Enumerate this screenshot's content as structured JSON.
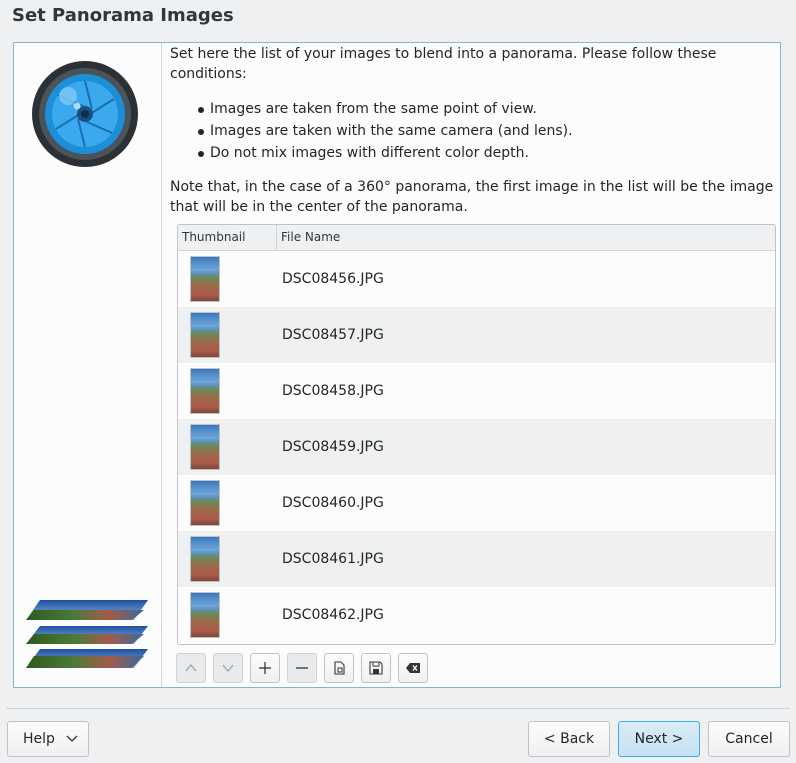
{
  "page_title": "Set Panorama Images",
  "intro": "Set here the list of your images to blend into a panorama. Please follow these conditions:",
  "conditions": [
    "Images are taken from the same point of view.",
    "Images are taken with the same camera (and lens).",
    "Do not mix images with different color depth."
  ],
  "note": "Note that, in the case of a 360° panorama, the first image in the list will be the image that will be in the center of the panorama.",
  "table": {
    "columns": [
      "Thumbnail",
      "File Name"
    ],
    "rows": [
      {
        "file": "DSC08456.JPG"
      },
      {
        "file": "DSC08457.JPG"
      },
      {
        "file": "DSC08458.JPG"
      },
      {
        "file": "DSC08459.JPG"
      },
      {
        "file": "DSC08460.JPG"
      },
      {
        "file": "DSC08461.JPG"
      },
      {
        "file": "DSC08462.JPG"
      }
    ]
  },
  "toolbar": {
    "move_up_icon": "arrow-up-icon",
    "move_down_icon": "arrow-down-icon",
    "add_icon": "plus-icon",
    "remove_icon": "minus-icon",
    "load_icon": "document-open-icon",
    "save_icon": "floppy-icon",
    "clear_icon": "clear-list-icon"
  },
  "buttons": {
    "help": "Help",
    "back": "< Back",
    "next": "Next >",
    "cancel": "Cancel"
  },
  "colors": {
    "accent": "#3daee9",
    "frame_border": "#7fb8d3"
  }
}
